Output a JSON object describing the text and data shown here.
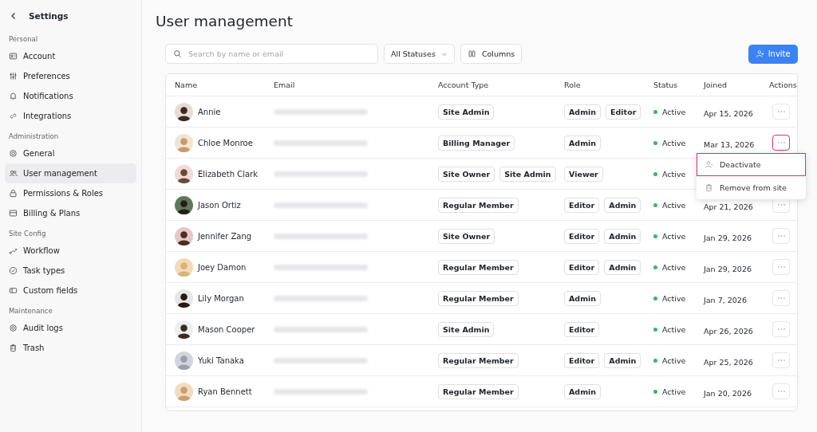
{
  "sidebar": {
    "title": "Settings",
    "sections": [
      {
        "label": "Personal",
        "items": [
          {
            "label": "Account",
            "selected": false
          },
          {
            "label": "Preferences",
            "selected": false
          },
          {
            "label": "Notifications",
            "selected": false
          },
          {
            "label": "Integrations",
            "selected": false
          }
        ]
      },
      {
        "label": "Administration",
        "items": [
          {
            "label": "General",
            "selected": false
          },
          {
            "label": "User management",
            "selected": true
          },
          {
            "label": "Permissions & Roles",
            "selected": false
          },
          {
            "label": "Billing & Plans",
            "selected": false
          }
        ]
      },
      {
        "label": "Site Config",
        "items": [
          {
            "label": "Workflow",
            "selected": false
          },
          {
            "label": "Task types",
            "selected": false
          },
          {
            "label": "Custom fields",
            "selected": false
          }
        ]
      },
      {
        "label": "Maintenance",
        "items": [
          {
            "label": "Audit logs",
            "selected": false
          },
          {
            "label": "Trash",
            "selected": false
          }
        ]
      }
    ]
  },
  "page_title": "User management",
  "toolbar": {
    "search": {
      "placeholder": "Search by name or email"
    },
    "status_filter": "All Statuses",
    "columns_button": "Columns",
    "invite_button": "Invite"
  },
  "table": {
    "columns": [
      "Name",
      "Email",
      "Account Type",
      "Role",
      "Status",
      "Joined",
      "Actions"
    ],
    "rows": [
      {
        "name": "Annie",
        "account_types": [
          "Site Admin"
        ],
        "roles": [
          "Admin",
          "Editor"
        ],
        "status": "Active",
        "joined": "Apr 15, 2026",
        "menu_open": false
      },
      {
        "name": "Chloe Monroe",
        "account_types": [
          "Billing Manager"
        ],
        "roles": [
          "Admin"
        ],
        "status": "Active",
        "joined": "Mar 13, 2026",
        "menu_open": true
      },
      {
        "name": "Elizabeth Clark",
        "account_types": [
          "Site Owner",
          "Site Admin"
        ],
        "roles": [
          "Viewer"
        ],
        "status": "Active"
      },
      {
        "name": "Jason Ortiz",
        "account_types": [
          "Regular Member"
        ],
        "roles": [
          "Editor",
          "Admin"
        ],
        "status": "Active",
        "joined": "Apr 21, 2026",
        "menu_open": false
      },
      {
        "name": "Jennifer Zang",
        "account_types": [
          "Site Owner"
        ],
        "roles": [
          "Editor",
          "Admin"
        ],
        "status": "Active",
        "joined": "Jan 29, 2026",
        "menu_open": false
      },
      {
        "name": "Joey Damon",
        "account_types": [
          "Regular Member"
        ],
        "roles": [
          "Editor",
          "Admin"
        ],
        "status": "Active",
        "joined": "Jan 29, 2026",
        "menu_open": false
      },
      {
        "name": "Lily Morgan",
        "account_types": [
          "Regular Member"
        ],
        "roles": [
          "Admin"
        ],
        "status": "Active",
        "joined": "Jan 7, 2026",
        "menu_open": false
      },
      {
        "name": "Mason Cooper",
        "account_types": [
          "Site Admin"
        ],
        "roles": [
          "Editor"
        ],
        "status": "Active",
        "joined": "Apr 26, 2026",
        "menu_open": false
      },
      {
        "name": "Yuki Tanaka",
        "account_types": [
          "Regular Member"
        ],
        "roles": [
          "Editor",
          "Admin"
        ],
        "status": "Active",
        "joined": "Apr 25, 2026",
        "menu_open": false
      },
      {
        "name": "Ryan Bennett",
        "account_types": [
          "Regular Member"
        ],
        "roles": [
          "Admin"
        ],
        "status": "Active",
        "joined": "Jan 20, 2026",
        "menu_open": false
      }
    ]
  },
  "action_menu": {
    "items": [
      {
        "label": "Deactivate",
        "selected": true
      },
      {
        "label": "Remove from site",
        "selected": false
      }
    ]
  }
}
